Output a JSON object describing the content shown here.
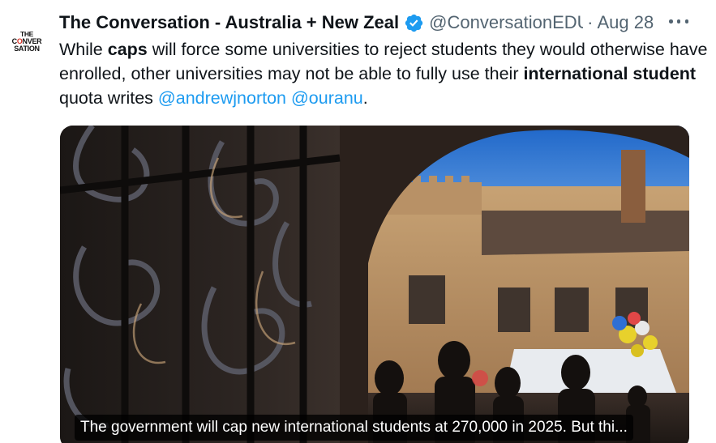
{
  "tweet": {
    "author_name": "The Conversation - Australia + New Zeal",
    "author_handle": "@ConversationEDU",
    "separator": "·",
    "date": "Aug 28",
    "avatar": {
      "logo_lines": [
        "THE",
        "CONVER",
        "SATION"
      ],
      "icon": "the-conversation-logo"
    },
    "verified_icon": "verified-badge-icon",
    "more_icon": "more-options-icon",
    "text_parts": {
      "p1": "While ",
      "b1": "caps",
      "p2": " will force some universities to reject students they would otherwise have enrolled, other universities may not be able to fully use their ",
      "b2": "international student",
      "p3": " quota writes ",
      "m1": "@andrewjnorton",
      "p4": " ",
      "m2": "@ouranu",
      "p5": "."
    },
    "card": {
      "caption": "The government will cap new international students at 270,000 in 2025. But thi..."
    },
    "colors": {
      "accent": "#1d9bf0",
      "text": "#0f1419",
      "secondary": "#536471",
      "logo_red": "#d8352a"
    }
  }
}
